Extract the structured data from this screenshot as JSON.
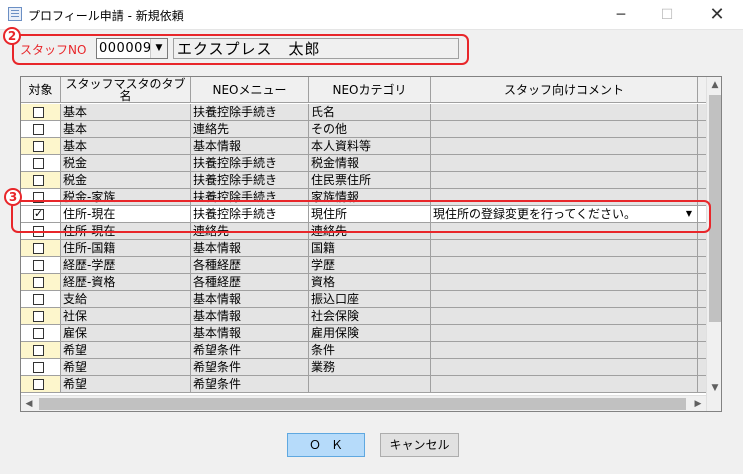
{
  "window": {
    "title": "プロフィール申請 - 新規依頼",
    "minimize_glyph": "─",
    "maximize_glyph": "☐",
    "close_glyph": "✕"
  },
  "callouts": {
    "staff": "2",
    "selected_row": "3",
    "color": "#e8262a"
  },
  "staff": {
    "label": "スタッフNO",
    "number": "000009",
    "name": "エクスプレス　太郎"
  },
  "grid": {
    "columns": [
      "対象",
      "スタッフマスタのタブ名",
      "NEOメニュー",
      "NEOカテゴリ",
      "スタッフ向けコメント"
    ],
    "rows": [
      {
        "checked": false,
        "tab": "基本",
        "menu": "扶養控除手続き",
        "category": "氏名",
        "comment": ""
      },
      {
        "checked": false,
        "tab": "基本",
        "menu": "連絡先",
        "category": "その他",
        "comment": ""
      },
      {
        "checked": false,
        "tab": "基本",
        "menu": "基本情報",
        "category": "本人資料等",
        "comment": ""
      },
      {
        "checked": false,
        "tab": "税金",
        "menu": "扶養控除手続き",
        "category": "税金情報",
        "comment": ""
      },
      {
        "checked": false,
        "tab": "税金",
        "menu": "扶養控除手続き",
        "category": "住民票住所",
        "comment": ""
      },
      {
        "checked": false,
        "tab": "税金-家族",
        "menu": "扶養控除手続き",
        "category": "家族情報",
        "comment": ""
      },
      {
        "checked": true,
        "tab": "住所-現在",
        "menu": "扶養控除手続き",
        "category": "現住所",
        "comment": "現住所の登録変更を行ってください。"
      },
      {
        "checked": false,
        "tab": "住所-現在",
        "menu": "連絡先",
        "category": "連絡先",
        "comment": ""
      },
      {
        "checked": false,
        "tab": "住所-国籍",
        "menu": "基本情報",
        "category": "国籍",
        "comment": ""
      },
      {
        "checked": false,
        "tab": "経歴-学歴",
        "menu": "各種経歴",
        "category": "学歴",
        "comment": ""
      },
      {
        "checked": false,
        "tab": "経歴-資格",
        "menu": "各種経歴",
        "category": "資格",
        "comment": ""
      },
      {
        "checked": false,
        "tab": "支給",
        "menu": "基本情報",
        "category": "振込口座",
        "comment": ""
      },
      {
        "checked": false,
        "tab": "社保",
        "menu": "基本情報",
        "category": "社会保険",
        "comment": ""
      },
      {
        "checked": false,
        "tab": "雇保",
        "menu": "基本情報",
        "category": "雇用保険",
        "comment": ""
      },
      {
        "checked": false,
        "tab": "希望",
        "menu": "希望条件",
        "category": "条件",
        "comment": ""
      },
      {
        "checked": false,
        "tab": "希望",
        "menu": "希望条件",
        "category": "業務",
        "comment": ""
      },
      {
        "checked": false,
        "tab": "希望",
        "menu": "希望条件",
        "category": "",
        "comment": ""
      }
    ],
    "selected_row_index": 6
  },
  "buttons": {
    "ok": "ＯＫ",
    "cancel": "キャンセル"
  }
}
